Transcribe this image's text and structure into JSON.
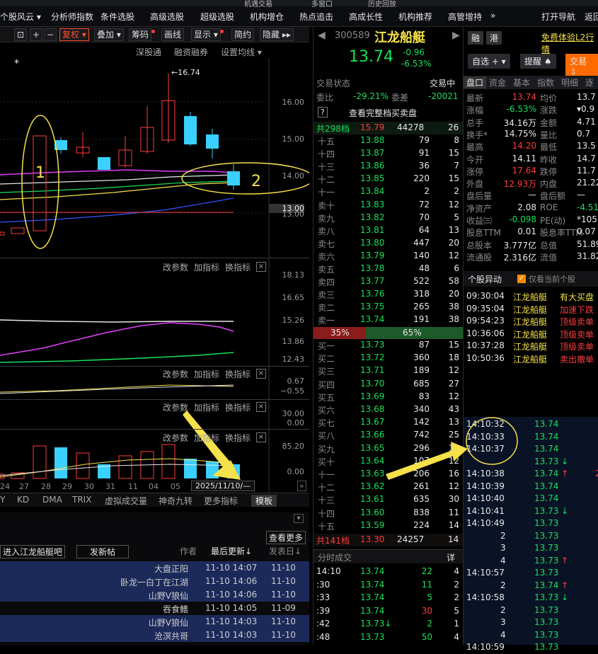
{
  "topnav": {
    "items": [
      "个股风云 ▾",
      "分析师指数",
      "条件选股",
      "高级选股",
      "超级选股",
      "机构增仓",
      "热点追击",
      "高成长性",
      "机构推荐",
      "高管增持",
      "»",
      "打开导航",
      "返回"
    ],
    "strip": [
      "机遇交易",
      "多窗口",
      "历史回放"
    ]
  },
  "toolbar": {
    "items": [
      "复权 ▾",
      "叠加 ▾",
      "筹码",
      "画线",
      "显示 ▾",
      "简约",
      "隐藏 ▸▸"
    ],
    "icons": [
      "⊡",
      "+",
      "−"
    ]
  },
  "subbar": {
    "items": [
      "深股通",
      "融资融券",
      "设置均线 ▾"
    ]
  },
  "kline": {
    "star": "*",
    "high_label": "←16.74",
    "annot1": "1",
    "annot2": "2",
    "axis": [
      "16.00",
      "15.00",
      "14.00",
      "13.00",
      "13.00"
    ]
  },
  "macd": {
    "buttons": [
      "改参数",
      "加指标",
      "换指标"
    ],
    "axis": [
      "18.13",
      "16.65",
      "15.26",
      "13.86",
      "12.43"
    ]
  },
  "ind2": {
    "buttons": [
      "改参数",
      "加指标",
      "换指标"
    ],
    "axis": [
      "0.67",
      "−0.55"
    ]
  },
  "ind3": {
    "buttons": [
      "改参数",
      "加指标",
      "换指标"
    ],
    "axis": [
      "30.00",
      "0.00"
    ]
  },
  "vol": {
    "buttons": [
      "改参数",
      "加指标",
      "换指标"
    ],
    "axis": [
      "85.20",
      "0.00"
    ],
    "dates": [
      "24",
      "27",
      "28",
      "29",
      "30",
      "31",
      "11",
      "04",
      "05"
    ],
    "date_box": "2025/11/10/—"
  },
  "tabs": {
    "items": [
      "Y",
      "KD",
      "DMA",
      "TRIX",
      "虚拟成交量",
      "神奇九转",
      "更多指标",
      "模板"
    ]
  },
  "forum": {
    "more": "查看更多",
    "enter": "进入江龙船艇吧",
    "post": "发新帖",
    "cols": [
      "作者",
      "最后更新↓",
      "发表日↓"
    ],
    "rows": [
      [
        "大盘正阳",
        "11-10 14:07",
        "11-10"
      ],
      [
        "卧龙一白丁在江湖",
        "11-10 14:06",
        "11-10"
      ],
      [
        "山野V狼仙",
        "11-10 14:06",
        "11-10"
      ],
      [
        "吞食鳍",
        "11-10 14:05",
        "11-09"
      ],
      [
        "山野V狼仙",
        "11-10 14:03",
        "11-10"
      ],
      [
        "沧溟共哥",
        "11-10 14:03",
        "11-10"
      ]
    ]
  },
  "stock": {
    "code": "300589",
    "name": "江龙船艇",
    "price": "13.74",
    "change": "-0.96",
    "pct": "-6.53%",
    "tags": [
      "融",
      "港"
    ],
    "promo": "免费体验L2行情",
    "btn_watch": "自选 + ▾",
    "btn_alert": "提醒 ♠",
    "btn_trade": "交易 ⇩"
  },
  "status": {
    "label": "交易状态",
    "value": "交易中",
    "weibi_label": "委比",
    "weibi": "-29.21%",
    "weicha_label": "委差",
    "weicha": "-20021",
    "full_label": "查看完整档买卖盘",
    "q": "?"
  },
  "sell_total": {
    "label": "共298档",
    "price": "15.79",
    "vol": "44278",
    "n": "26"
  },
  "asks": [
    [
      "十五",
      "13.88",
      "79",
      "8"
    ],
    [
      "十四",
      "13.87",
      "91",
      "15"
    ],
    [
      "十三",
      "13.86",
      "36",
      "7"
    ],
    [
      "十二",
      "13.85",
      "220",
      "15"
    ],
    [
      "十一",
      "13.84",
      "2",
      "2"
    ],
    [
      "卖十",
      "13.83",
      "72",
      "12"
    ],
    [
      "卖九",
      "13.82",
      "70",
      "5"
    ],
    [
      "卖八",
      "13.81",
      "64",
      "13"
    ],
    [
      "卖七",
      "13.80",
      "447",
      "20"
    ],
    [
      "卖六",
      "13.79",
      "140",
      "12"
    ],
    [
      "卖五",
      "13.78",
      "48",
      "6"
    ],
    [
      "卖四",
      "13.77",
      "522",
      "58"
    ],
    [
      "卖三",
      "13.76",
      "318",
      "20"
    ],
    [
      "卖二",
      "13.75",
      "265",
      "38"
    ],
    [
      "卖一",
      "13.74",
      "191",
      "38"
    ]
  ],
  "ratio": {
    "buy": "35%",
    "sell": "65%"
  },
  "bids": [
    [
      "买一",
      "13.73",
      "87",
      "15"
    ],
    [
      "买二",
      "13.72",
      "360",
      "18"
    ],
    [
      "买三",
      "13.71",
      "189",
      "12"
    ],
    [
      "买四",
      "13.70",
      "685",
      "27"
    ],
    [
      "买五",
      "13.69",
      "83",
      "12"
    ],
    [
      "买六",
      "13.68",
      "340",
      "43"
    ],
    [
      "买七",
      "13.67",
      "142",
      "13"
    ],
    [
      "买八",
      "13.66",
      "742",
      "25"
    ],
    [
      "买九",
      "13.65",
      "296",
      "13"
    ],
    [
      "买十",
      "13.64",
      "107",
      "12"
    ],
    [
      "十一",
      "13.63",
      "206",
      "16"
    ],
    [
      "十二",
      "13.62",
      "261",
      "12"
    ],
    [
      "十三",
      "13.61",
      "635",
      "30"
    ],
    [
      "十四",
      "13.60",
      "838",
      "11"
    ],
    [
      "十五",
      "13.59",
      "224",
      "14"
    ]
  ],
  "buy_total": {
    "label": "共141档",
    "price": "13.30",
    "vol": "24257",
    "n": "14"
  },
  "ticks_header": {
    "label": "分时成交",
    "btn": "详"
  },
  "ticks": [
    [
      "14:10",
      "13.74",
      "22",
      "4"
    ],
    [
      ":30",
      "13.74",
      "11",
      "2"
    ],
    [
      ":33",
      "13.74",
      "5",
      "2"
    ],
    [
      ":39",
      "13.74",
      "30",
      "5"
    ],
    [
      ":42",
      "13.73↓",
      "2",
      "1"
    ],
    [
      ":48",
      "13.73",
      "50",
      "4"
    ]
  ],
  "panel_tabs": [
    "盘口",
    "资金",
    "基本",
    "指数",
    "明细",
    "逐"
  ],
  "stats": [
    [
      "最新",
      "13.74",
      "均价",
      "13.7"
    ],
    [
      "涨幅",
      "-6.53%",
      "涨跌",
      "▾0.9"
    ],
    [
      "总手",
      "34.16万",
      "金额",
      "4.71"
    ],
    [
      "换手*",
      "14.75%",
      "量比",
      "0.7"
    ],
    [
      "最高",
      "14.20",
      "最低",
      "13.5"
    ],
    [
      "今开",
      "14.11",
      "昨收",
      "14.7"
    ],
    [
      "涨停",
      "17.64",
      "跌停",
      "11.7"
    ],
    [
      "外盘",
      "12.93万",
      "内盘",
      "21.22"
    ],
    [
      "盘后量",
      "—",
      "盘后额",
      "—"
    ],
    [
      "净资产",
      "2.08",
      "ROE",
      "-4.51"
    ],
    [
      "收益㈢",
      "-0.098",
      "PE(动)",
      "*105.5"
    ],
    [
      "股息TTM",
      "0.01",
      "股息率TTM",
      "0.07"
    ],
    [
      "总股本",
      "3.777亿",
      "总值",
      "51.89"
    ],
    [
      "流通股",
      "2.316亿",
      "流值",
      "31.82"
    ]
  ],
  "movers": {
    "title": "个股异动",
    "check": "仅看当前个股",
    "rows": [
      [
        "09:30:04",
        "江龙船艇",
        "有大买盘"
      ],
      [
        "09:35:04",
        "江龙船艇",
        "加速下跌"
      ],
      [
        "09:54:23",
        "江龙船艇",
        "顶级卖单"
      ],
      [
        "10:36:06",
        "江龙船艇",
        "顶级卖单"
      ],
      [
        "10:37:28",
        "江龙船艇",
        "顶级卖单"
      ],
      [
        "10:50:36",
        "江龙船艇",
        "卖出撤单"
      ]
    ]
  },
  "trades": [
    [
      "14:10:32",
      "13.74",
      ""
    ],
    [
      "14:10:33",
      "13.74",
      ""
    ],
    [
      "14:10:37",
      "13.74",
      ""
    ],
    [
      "",
      "13.73↓",
      ""
    ],
    [
      "14:10:38",
      "13.74↑",
      "2"
    ],
    [
      "14:10:39",
      "13.74",
      ""
    ],
    [
      "14:10:40",
      "13.74",
      ""
    ],
    [
      "14:10:41",
      "13.73↓",
      ""
    ],
    [
      "14:10:49",
      "13.73",
      ""
    ],
    [
      "2",
      "13.73",
      ""
    ],
    [
      "3",
      "13.73",
      ""
    ],
    [
      "4",
      "13.73↑",
      ""
    ],
    [
      "14:10:57",
      "13.73",
      ""
    ],
    [
      "2",
      "13.74↑",
      ""
    ],
    [
      "14:10:58",
      "13.73↓",
      ""
    ],
    [
      "2",
      "13.73",
      ""
    ],
    [
      "3",
      "13.73",
      ""
    ],
    [
      "4",
      "13.73",
      ""
    ],
    [
      "14:10:59",
      "13.73",
      ""
    ]
  ],
  "colors": {
    "up": "#ff3b3b",
    "down": "#19e05a",
    "flat": "#e8e8e8",
    "accent": "#f5e14a",
    "cyan": "#3ad0ff"
  }
}
